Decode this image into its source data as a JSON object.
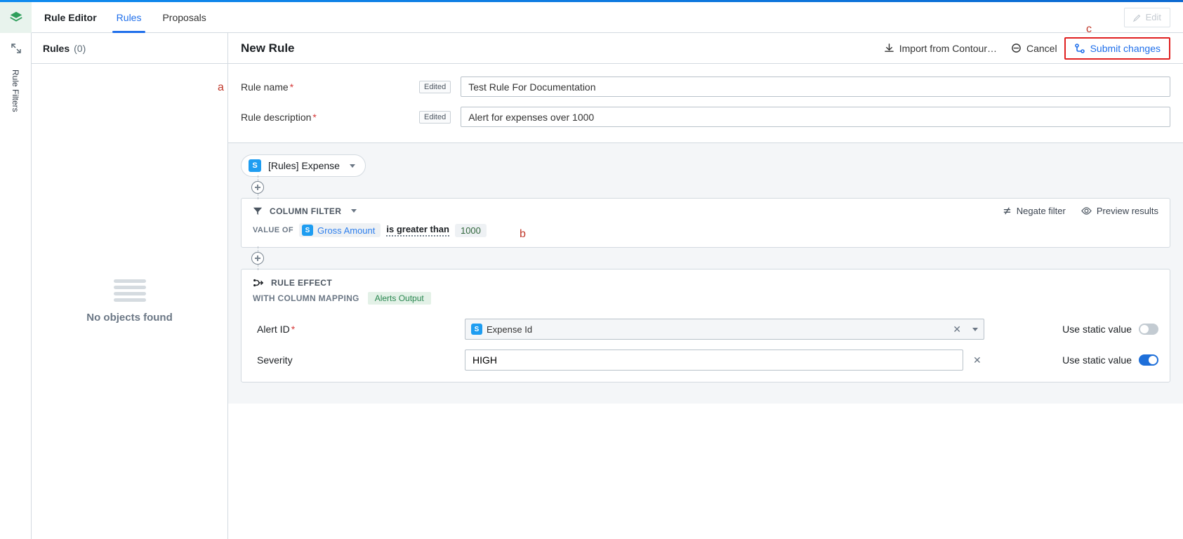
{
  "header": {
    "title": "Rule Editor",
    "tabs": {
      "rules": "Rules",
      "proposals": "Proposals"
    },
    "edit": "Edit"
  },
  "leftRail": {
    "section": "Rule Filters"
  },
  "rulesSidebar": {
    "heading": "Rules",
    "count": "(0)",
    "empty": "No objects found"
  },
  "mainHeader": {
    "title": "New Rule",
    "import": "Import from Contour…",
    "cancel": "Cancel",
    "submit": "Submit changes"
  },
  "metaForm": {
    "nameLabel": "Rule name",
    "nameEdited": "Edited",
    "nameValue": "Test Rule For Documentation",
    "descLabel": "Rule description",
    "descEdited": "Edited",
    "descValue": "Alert for expenses over 1000"
  },
  "source": {
    "label": "[Rules] Expense"
  },
  "filter": {
    "heading": "COLUMN FILTER",
    "negate": "Negate filter",
    "preview": "Preview results",
    "valueOf": "VALUE OF",
    "column": "Gross Amount",
    "operator": "is greater than",
    "value": "1000"
  },
  "effect": {
    "heading": "RULE EFFECT",
    "mappingLabel": "WITH COLUMN MAPPING",
    "mappingValue": "Alerts Output",
    "rows": {
      "alertId": {
        "label": "Alert ID",
        "value": "Expense Id",
        "staticLabel": "Use static value"
      },
      "severity": {
        "label": "Severity",
        "value": "HIGH",
        "staticLabel": "Use static value"
      }
    }
  },
  "callouts": {
    "a": "a",
    "b": "b",
    "c": "c"
  }
}
